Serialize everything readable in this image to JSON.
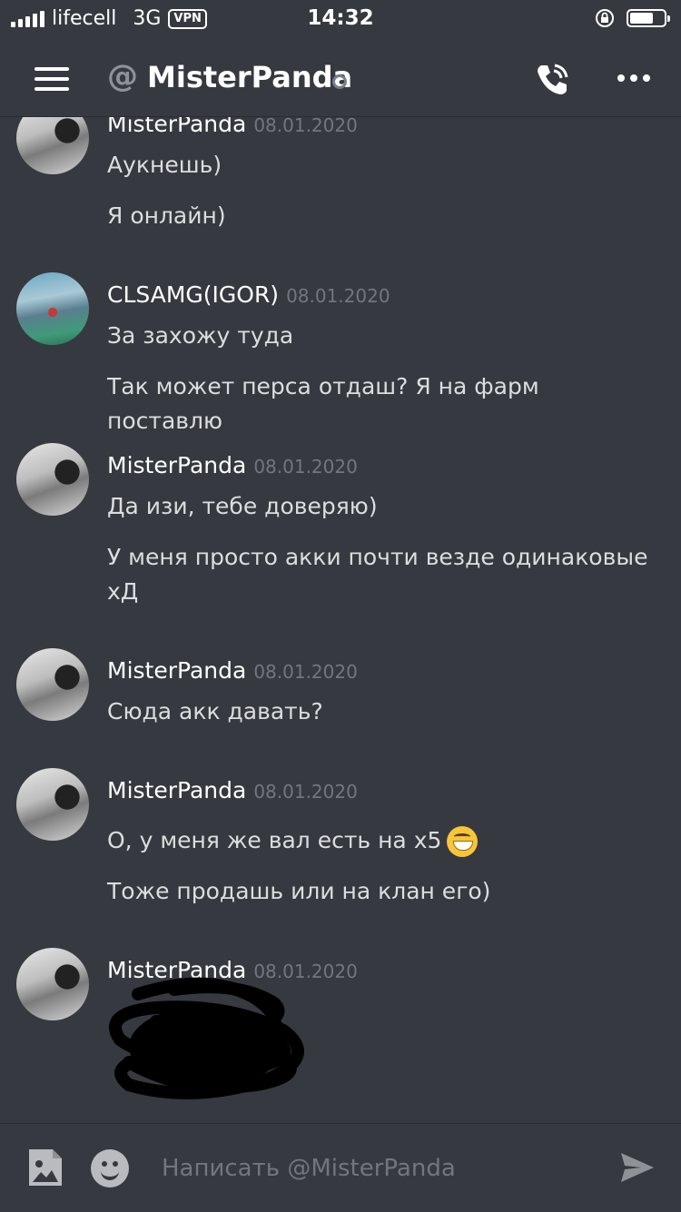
{
  "status_bar": {
    "carrier": "lifecell",
    "network": "3G",
    "vpn": "VPN",
    "time": "14:32"
  },
  "header": {
    "at_symbol": "@",
    "title": "MisterPanda"
  },
  "messages": [
    {
      "author": "MisterPanda",
      "timestamp": "08.01.2020",
      "avatar": "misterpanda-avatar",
      "lines": [
        "Аукнешь)",
        "Я онлайн)"
      ]
    },
    {
      "author": "CLSAMG(IGOR)",
      "timestamp": "08.01.2020",
      "avatar": "clsamg-avatar",
      "lines": [
        "За захожу туда",
        "Так может перса отдаш? Я на фарм поставлю"
      ]
    },
    {
      "author": "MisterPanda",
      "timestamp": "08.01.2020",
      "avatar": "misterpanda-avatar",
      "lines": [
        "Да изи, тебе доверяю)",
        "У меня просто акки почти везде одинаковые хД"
      ]
    },
    {
      "author": "MisterPanda",
      "timestamp": "08.01.2020",
      "avatar": "misterpanda-avatar",
      "lines": [
        "Сюда акк давать?"
      ]
    },
    {
      "author": "MisterPanda",
      "timestamp": "08.01.2020",
      "avatar": "misterpanda-avatar",
      "lines": [
        "О,  у меня же вал есть на х5",
        "Тоже продашь или на клан его)"
      ],
      "emoji": "grinning-emoji"
    },
    {
      "author": "MisterPanda",
      "timestamp": "08.01.2020",
      "avatar": "misterpanda-avatar",
      "lines": [],
      "redacted": true
    }
  ],
  "composer": {
    "placeholder": "Написать @MisterPanda"
  },
  "colors": {
    "background": "#36393f",
    "text": "#dcddde",
    "muted": "#72767d",
    "white": "#ffffff"
  }
}
